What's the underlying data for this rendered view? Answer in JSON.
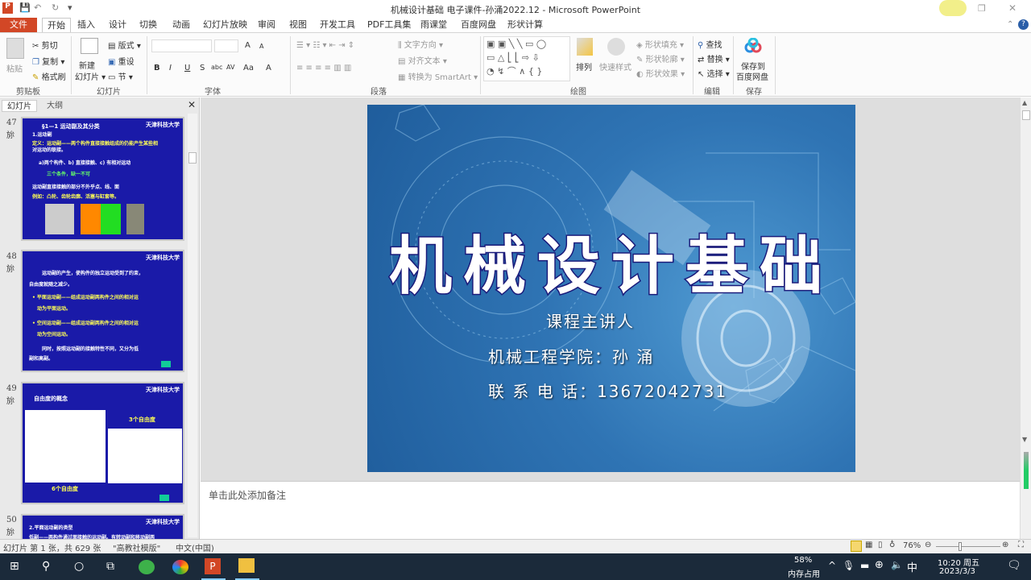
{
  "window": {
    "title": "机械设计基础 电子课件-孙涌2022.12 - Microsoft PowerPoint"
  },
  "quick_access": {
    "save": "💾",
    "undo": "↶",
    "redo": "↻",
    "customize": "▾"
  },
  "tabs": [
    "文件",
    "开始",
    "插入",
    "设计",
    "切换",
    "动画",
    "幻灯片放映",
    "审阅",
    "视图",
    "开发工具",
    "PDF工具集",
    "雨课堂",
    "百度网盘",
    "形状计算"
  ],
  "ribbon": {
    "clipboard": {
      "paste": "粘贴",
      "cut": "剪切",
      "copy": "复制",
      "format_painter": "格式刷",
      "label": "剪贴板"
    },
    "slides": {
      "new_slide": "新建",
      "new_slide2": "幻灯片",
      "layout": "版式",
      "reset": "重设",
      "section": "节",
      "label": "幻灯片"
    },
    "font": {
      "label": "字体",
      "bold": "B",
      "italic": "I",
      "underline": "U",
      "strike": "S",
      "abc": "abc",
      "spacing": "AV",
      "case": "Aa",
      "color": "A",
      "grow": "A",
      "shrink": "A"
    },
    "paragraph": {
      "text_direction": "文字方向",
      "align_text": "对齐文本",
      "smartart": "转换为 SmartArt",
      "label": "段落"
    },
    "drawing": {
      "arrange": "排列",
      "quick_styles": "快速样式",
      "fill": "形状填充",
      "outline": "形状轮廓",
      "effects": "形状效果",
      "label": "绘图"
    },
    "editing": {
      "find": "查找",
      "replace": "替换",
      "select": "选择",
      "label": "编辑"
    },
    "save": {
      "save_to": "保存到",
      "baidu": "百度网盘",
      "label": "保存"
    }
  },
  "pane": {
    "tab_slides": "幻灯片",
    "tab_outline": "大纲",
    "close": "✕"
  },
  "thumbnails": [
    {
      "num": "47",
      "icon": "旀",
      "logo": "天津科技大学",
      "lines": [
        "§1—1  运动副及其分类",
        "1.运动副",
        "定义：运动副——两个构件直接接触组成的仍能产生某些相",
        "对运动的联接。",
        "a)两个构件、b) 直接接触、c) 有相对运动",
        "三个条件，缺一不可",
        "运动副直接接触的部分不外乎点、线、面",
        "例如：凸轮、齿轮齿廓、活塞与缸套等。"
      ]
    },
    {
      "num": "48",
      "icon": "旀",
      "logo": "天津科技大学",
      "lines": [
        "运动副的产生，使构件的独立运动受到了约束，",
        "自由度就随之减少。",
        "•  平面运动副——组成运动副两构件之间的相对运",
        "动为平面运动。",
        "•  空间运动副——组成运动副两构件之间的相对运",
        "动为空间运动。",
        "同时，按照运动副的接触特性不同，又分为低",
        "副和高副。"
      ]
    },
    {
      "num": "49",
      "icon": "旀",
      "logo": "天津科技大学",
      "lines": [
        "自由度的概念",
        "3个自由度",
        "6个自由度"
      ]
    },
    {
      "num": "50",
      "icon": "旀",
      "logo": "天津科技大学",
      "lines": [
        "2.平面运动副的类型",
        "低副——两构件通过面接触的运动副。有转动副和移动副两"
      ]
    }
  ],
  "slide": {
    "title": "机械设计基础",
    "lecturer_label": "课程主讲人",
    "college": "机械工程学院：孙        涌",
    "phone": "联 系 电   话：13672042731"
  },
  "notes": {
    "placeholder": "单击此处添加备注"
  },
  "status": {
    "slide_info": "幻灯片 第 1 张，共 629 张",
    "theme": "\"高教社模版\"",
    "language": "中文(中国)",
    "zoom": "76%"
  },
  "taskbar": {
    "memory_pct": "58%",
    "memory_label": "内存占用",
    "ime": "中",
    "time": "10:20 周五",
    "date": "2023/3/3"
  }
}
